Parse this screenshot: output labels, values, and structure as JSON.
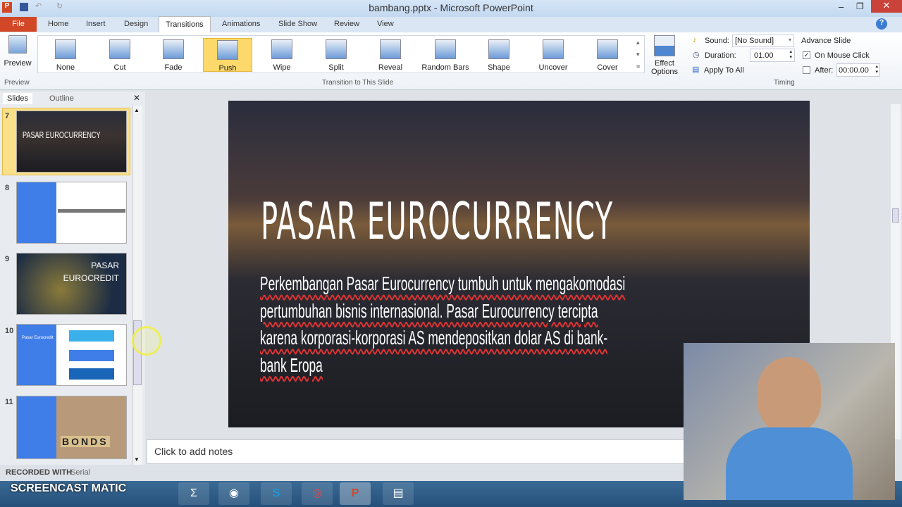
{
  "window": {
    "title": "bambang.pptx - Microsoft PowerPoint"
  },
  "tabs": {
    "file": "File",
    "items": [
      "Home",
      "Insert",
      "Design",
      "Transitions",
      "Animations",
      "Slide Show",
      "Review",
      "View"
    ]
  },
  "ribbon": {
    "preview": {
      "button": "Preview",
      "group": "Preview"
    },
    "transitions": [
      "None",
      "Cut",
      "Fade",
      "Push",
      "Wipe",
      "Split",
      "Reveal",
      "Random Bars",
      "Shape",
      "Uncover",
      "Cover"
    ],
    "selected": "Push",
    "effect_options": "Effect Options",
    "group_transition": "Transition to This Slide",
    "timing": {
      "sound_label": "Sound:",
      "sound_value": "[No Sound]",
      "duration_label": "Duration:",
      "duration_value": "01.00",
      "apply_all": "Apply To All",
      "advance": "Advance Slide",
      "on_click": "On Mouse Click",
      "on_click_checked": true,
      "after_label": "After:",
      "after_value": "00:00.00",
      "after_checked": false,
      "group": "Timing"
    }
  },
  "panel": {
    "tab_slides": "Slides",
    "tab_outline": "Outline",
    "slides": [
      {
        "n": "7",
        "title": "PASAR EUROCURRENCY"
      },
      {
        "n": "8",
        "title": ""
      },
      {
        "n": "9",
        "title": "PASAR EUROCREDIT"
      },
      {
        "n": "10",
        "title": "Pasar Eurocredit"
      },
      {
        "n": "11",
        "title": "BONDS"
      }
    ]
  },
  "slide": {
    "title": "PASAR EUROCURRENCY",
    "body": "Perkembangan Pasar Eurocurrency tumbuh untuk mengakomodasi pertumbuhan bisnis internasional. Pasar Eurocurrency tercipta karena korporasi-korporasi AS mendepositkan dolar AS di bank-bank Eropa"
  },
  "notes": {
    "placeholder": "Click to add notes"
  },
  "watermark": {
    "recorded": "RECORDED WITH",
    "brand": "SCREENCAST MATIC"
  },
  "status": {
    "text": "Serial"
  },
  "colors": {
    "file_tab": "#d24726",
    "selected_transition": "#fcd96a",
    "thumb_blue": "#3f7ee8"
  }
}
